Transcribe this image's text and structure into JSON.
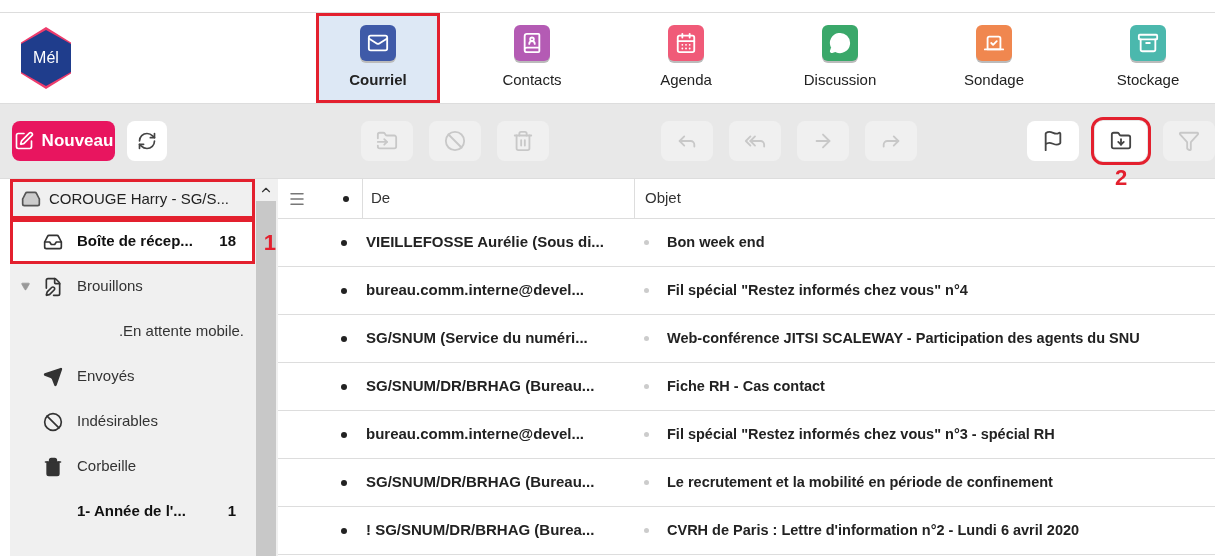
{
  "logo_text": "Mél",
  "nav": [
    {
      "label": "Courriel",
      "kind": "mail",
      "color": "#3f5aa8",
      "selected": true,
      "outlined": true
    },
    {
      "label": "Contacts",
      "kind": "contacts",
      "color": "#b45bb4",
      "selected": false,
      "outlined": false
    },
    {
      "label": "Agenda",
      "kind": "calendar",
      "color": "#f05a78",
      "selected": false,
      "outlined": false
    },
    {
      "label": "Discussion",
      "kind": "chat",
      "color": "#3aa86a",
      "selected": false,
      "outlined": false
    },
    {
      "label": "Sondage",
      "kind": "poll",
      "color": "#f0874f",
      "selected": false,
      "outlined": false
    },
    {
      "label": "Stockage",
      "kind": "storage",
      "color": "#4bb8ad",
      "selected": false,
      "outlined": false
    }
  ],
  "new_button": {
    "label": "Nouveau"
  },
  "toolbar_buttons": [
    {
      "kind": "move",
      "disabled": true,
      "outlined": false
    },
    {
      "kind": "block",
      "disabled": true,
      "outlined": false
    },
    {
      "kind": "delete",
      "disabled": true,
      "outlined": false
    },
    {
      "kind": "reply",
      "disabled": true,
      "outlined": false
    },
    {
      "kind": "reply_all",
      "disabled": true,
      "outlined": false
    },
    {
      "kind": "forward",
      "disabled": true,
      "outlined": false
    },
    {
      "kind": "redirect",
      "disabled": true,
      "outlined": false
    },
    {
      "kind": "flag",
      "disabled": false,
      "outlined": false
    },
    {
      "kind": "download",
      "disabled": false,
      "outlined": true,
      "callout": "2"
    },
    {
      "kind": "filter",
      "disabled": true,
      "outlined": false
    }
  ],
  "account": {
    "label": "COROUGE Harry - SG/S...",
    "outlined": true
  },
  "folders": [
    {
      "label": "Boîte de récep...",
      "kind": "inbox",
      "count": "18",
      "unread": true,
      "selected": true,
      "outlined": true,
      "callout": "1"
    },
    {
      "label": "Brouillons",
      "kind": "drafts",
      "unread": false,
      "selected": false,
      "outlined": false,
      "expanded": true,
      "children": [
        {
          "label": ".En attente mobile.",
          "unread": false,
          "selected": false,
          "outlined": false
        }
      ]
    },
    {
      "label": "Envoyés",
      "kind": "sent",
      "unread": false,
      "selected": false,
      "outlined": false
    },
    {
      "label": "Indésirables",
      "kind": "junk",
      "unread": false,
      "selected": false,
      "outlined": false
    },
    {
      "label": "Corbeille",
      "kind": "trash",
      "unread": false,
      "selected": false,
      "outlined": false
    },
    {
      "label": "1- Année de l'...",
      "count": "1",
      "unread": true,
      "selected": false,
      "outlined": false
    }
  ],
  "table": {
    "columns": [
      "De",
      "Objet"
    ],
    "rows": [
      {
        "from": "VIEILLEFOSSE Aurélie (Sous di...",
        "subject": "Bon week end",
        "unread": true
      },
      {
        "from": "bureau.comm.interne@devel...",
        "subject": "Fil spécial \"Restez informés chez vous\" n°4",
        "unread": true
      },
      {
        "from": "SG/SNUM (Service du numéri...",
        "subject": "Web-conférence JITSI SCALEWAY - Participation des agents du SNU",
        "unread": true
      },
      {
        "from": "SG/SNUM/DR/BRHAG (Bureau...",
        "subject": "Fiche RH - Cas contact",
        "unread": true
      },
      {
        "from": "bureau.comm.interne@devel...",
        "subject": "Fil spécial \"Restez informés chez vous\" n°3 - spécial RH",
        "unread": true
      },
      {
        "from": "SG/SNUM/DR/BRHAG (Bureau...",
        "subject": "Le recrutement et la mobilité en période de confinement",
        "unread": true
      },
      {
        "from": "! SG/SNUM/DR/BRHAG (Burea...",
        "subject": "CVRH de Paris : Lettre d'information n°2 - Lundi 6 avril 2020",
        "unread": true
      }
    ]
  }
}
